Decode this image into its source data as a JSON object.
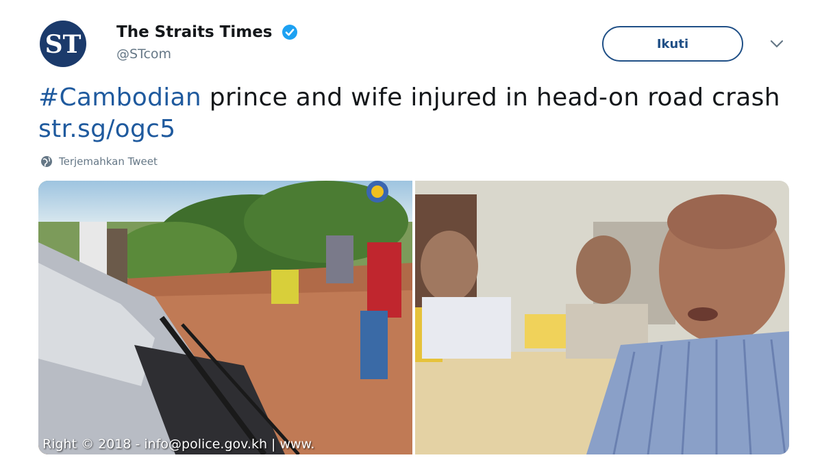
{
  "account": {
    "display_name": "The Straits Times",
    "handle": "@STcom",
    "logo_text": "ST",
    "verified_icon": "verified-badge-icon"
  },
  "actions": {
    "follow_label": "Ikuti",
    "more_icon": "chevron-down-icon"
  },
  "tweet": {
    "hashtag": "#Cambodian",
    "text_body": " prince and wife injured in head-on road crash ",
    "link": "str.sg/ogc5",
    "translate_label": "Terjemahkan Tweet",
    "translate_icon": "globe-icon"
  },
  "media": {
    "left_watermark": "Right © 2018 - info@police.gov.kh | www.",
    "right_caption": ""
  },
  "colors": {
    "link": "#1f5a9e",
    "follow_border": "#1f4f86",
    "secondary_text": "#657786",
    "verified": "#1da1f2"
  }
}
